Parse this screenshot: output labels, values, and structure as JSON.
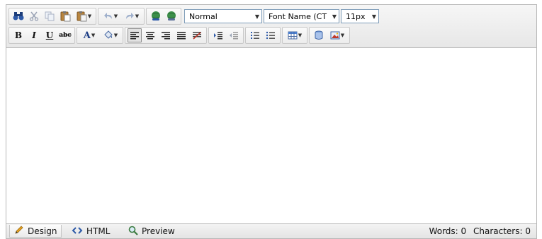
{
  "toolbar": {
    "row1": {
      "paragraph_format": "Normal",
      "font_name": "Font Name (CT",
      "font_size": "11px"
    },
    "row2": {
      "bold_label": "B",
      "italic_label": "I",
      "underline_label": "U",
      "strikethrough_label": "abc",
      "font_color_label": "A"
    }
  },
  "modes": {
    "design": "Design",
    "html": "HTML",
    "preview": "Preview"
  },
  "status": {
    "words": "Words: 0",
    "characters": "Characters: 0"
  },
  "colors": {
    "accent_blue": "#2e5aa8",
    "toolbar_bg": "#ececec",
    "border": "#b7b7b7"
  }
}
